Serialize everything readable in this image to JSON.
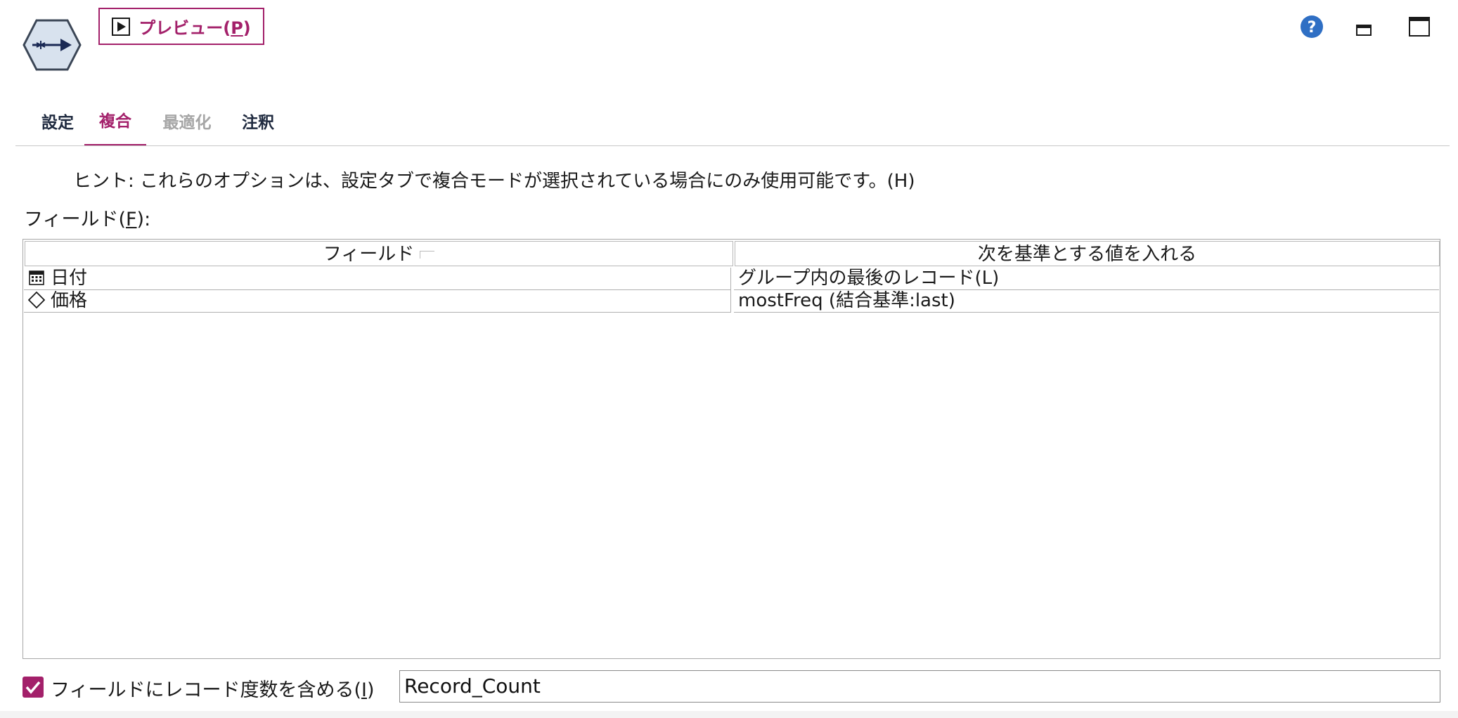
{
  "toolbar": {
    "preview_label_main": "プレビュー(",
    "preview_label_key": "P",
    "preview_label_end": ")"
  },
  "window_controls": {
    "help": "help-icon",
    "minimize": "minimize-icon",
    "maximize": "maximize-icon"
  },
  "tabs": [
    {
      "label": "設定",
      "state": "normal"
    },
    {
      "label": "複合",
      "state": "active"
    },
    {
      "label": "最適化",
      "state": "disabled"
    },
    {
      "label": "注釈",
      "state": "normal"
    }
  ],
  "hint": "ヒント: これらのオプションは、設定タブで複合モードが選択されている場合にのみ使用可能です。(H)",
  "fields_label_main": "フィールド(",
  "fields_label_key": "F",
  "fields_label_end": "):",
  "table": {
    "headers": [
      "フィールド",
      "次を基準とする値を入れる"
    ],
    "rows": [
      {
        "icon": "calendar-icon",
        "field": "日付",
        "value": "グループ内の最後のレコード(L)"
      },
      {
        "icon": "continuous-diamond-icon",
        "field": "価格",
        "value": "mostFreq (結合基準:last)"
      }
    ]
  },
  "include_count": {
    "checked": true,
    "label_main": "フィールドにレコード度数を含める(",
    "label_key": "I",
    "label_end": ")",
    "field_value": "Record_Count"
  },
  "colors": {
    "accent": "#a3206a",
    "tab_text": "#1f2a3f",
    "disabled": "#a6a6a6",
    "help_blue": "#2f6fc4"
  }
}
